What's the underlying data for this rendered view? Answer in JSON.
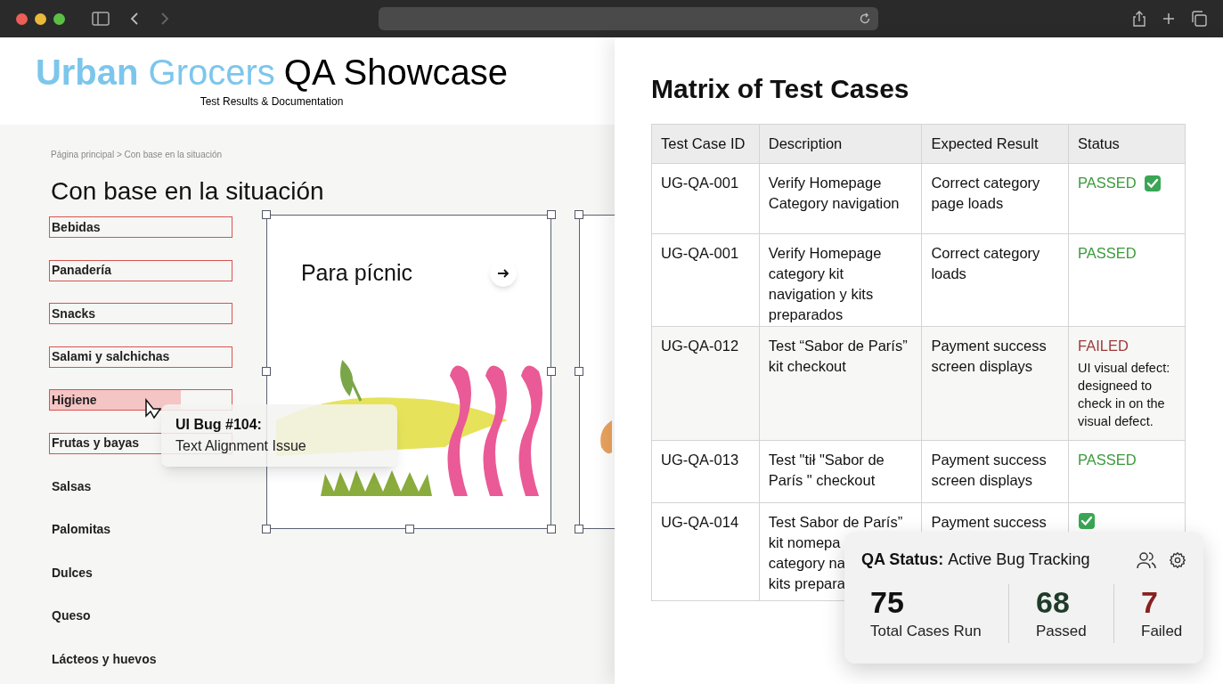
{
  "header": {
    "brand": "**Urban** Grocers",
    "title": "QA Showcase",
    "subtitle": "Test Results & Documentation"
  },
  "breadcrumb": "Página principal > Con base en la situación",
  "heading": "Con base en la situación",
  "categories": [
    {
      "label": "Bebidas",
      "flagged": true
    },
    {
      "label": "Panadería",
      "flagged": true
    },
    {
      "label": "Snacks",
      "flagged": true
    },
    {
      "label": "Salami y salchichas",
      "flagged": true
    },
    {
      "label": "Higiene",
      "flagged": true,
      "level": 0.72
    },
    {
      "label": "Frutas y bayas",
      "flagged": true
    },
    {
      "label": "Salsas",
      "flagged": false
    },
    {
      "label": "Palomitas",
      "flagged": false
    },
    {
      "label": "Dulces",
      "flagged": false
    },
    {
      "label": "Queso",
      "flagged": false
    },
    {
      "label": "Lácteos y huevos",
      "flagged": false
    }
  ],
  "card": {
    "title": "Para pícnic"
  },
  "tooltip": {
    "title": "UI Bug #104:",
    "text": "Text Alignment Issue"
  },
  "matrix": {
    "title": "Matrix of Test Cases",
    "columns": [
      "Test Case ID",
      "Description",
      "Expected Result",
      "Status"
    ],
    "rows": [
      {
        "id": "UG-QA-001",
        "description": "Verify Homepage\nCategory navigation",
        "expected": "Correct category\npage loads",
        "status": "PASSED",
        "kind": "passed",
        "check": true
      },
      {
        "id": "UG-QA-001",
        "description": "Verify Homepage\ncategory kit\nnavigation y kits\npreparados",
        "expected": "Correct category\nloads",
        "status": "PASSED",
        "kind": "passed",
        "check": false
      },
      {
        "id": "UG-QA-012",
        "description": "Test “Sabor de París”\nkit checkout",
        "expected": "Payment success\nscreen displays",
        "status": "FAILED",
        "kind": "failed",
        "note": "UI visual defect:\ndesigneed to\ncheck in on the\nvisual defect.",
        "check": false
      },
      {
        "id": "UG-QA-013",
        "description": "Test \"tił \"Sabor de\nParís \" checkout",
        "expected": "Payment success\nscreen displays",
        "status": "PASSED",
        "kind": "passed",
        "check": false
      },
      {
        "id": "UG-QA-014",
        "description": "Test Sabor de París”\nkit nomepa\ncategory na\nkits prepara",
        "expected": "Payment success",
        "kind": "passed",
        "check": true
      }
    ]
  },
  "qa_status": {
    "label": "QA Status:",
    "value": "Active Bug Tracking",
    "stats": [
      {
        "value": "75",
        "label": "Total Cases Run",
        "kind": "total"
      },
      {
        "value": "68",
        "label": "Passed",
        "kind": "passed"
      },
      {
        "value": "7",
        "label": "Failed",
        "kind": "failed"
      }
    ]
  }
}
